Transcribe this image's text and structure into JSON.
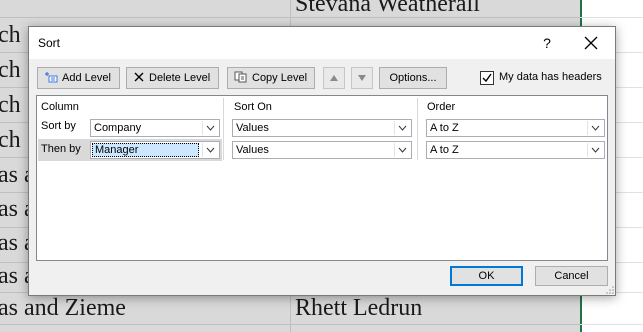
{
  "spreadsheet": {
    "col_a_rows": [
      "ch",
      "ch",
      "ch",
      "ch",
      "as a",
      "as a",
      "as a",
      "as a",
      "as and Zieme"
    ],
    "col_b_top": "Stevana Weatherall",
    "col_b_bottom": "Rhett Ledrun"
  },
  "dialog": {
    "title": "Sort",
    "help": "?",
    "toolbar": {
      "add_level": "Add Level",
      "delete_level": "Delete Level",
      "copy_level": "Copy Level",
      "options": "Options...",
      "my_data_has_headers": "My data has headers",
      "headers_checked": true
    },
    "columns": {
      "column": "Column",
      "sort_on": "Sort On",
      "order": "Order"
    },
    "levels": [
      {
        "label": "Sort by",
        "column": "Company",
        "sort_on": "Values",
        "order": "A to Z"
      },
      {
        "label": "Then by",
        "column": "Manager",
        "sort_on": "Values",
        "order": "A to Z"
      }
    ],
    "ok": "OK",
    "cancel": "Cancel"
  }
}
